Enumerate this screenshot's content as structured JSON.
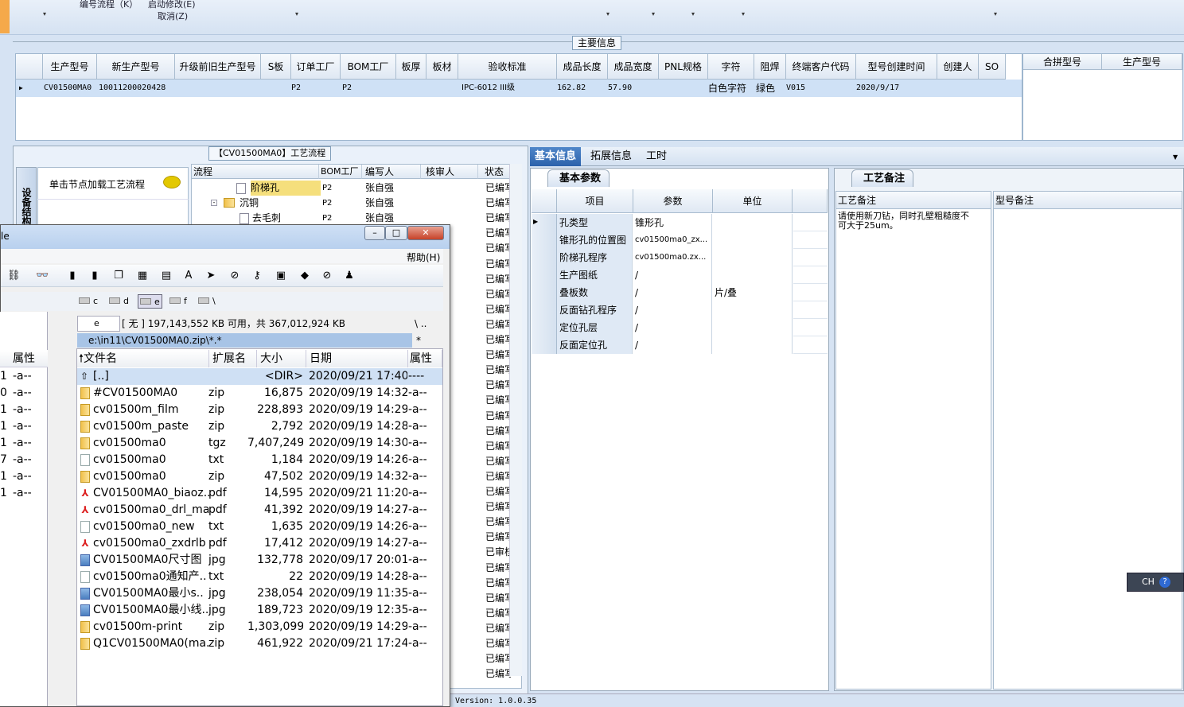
{
  "topbar": {
    "menu1": "编号流程（K）",
    "menu2": "启动修改(E)",
    "menu3": "取消(Z)",
    "dropdown_glyph": "▾"
  },
  "main_info": {
    "title": "主要信息",
    "columns": [
      "生产型号",
      "新生产型号",
      "升级前旧生产型号",
      "S板",
      "订单工厂",
      "BOM工厂",
      "板厚",
      "板材",
      "验收标准",
      "成品长度",
      "成品宽度",
      "PNL规格",
      "字符",
      "阻焊",
      "终端客户代码",
      "型号创建时间",
      "创建人",
      "SO"
    ],
    "row": [
      "CV01500MA0",
      "10011200020428",
      "",
      "",
      "P2",
      "P2",
      "",
      "",
      "IPC-6012 III级",
      "162.82",
      "57.90",
      "",
      "白色字符",
      "绿色",
      "V015",
      "2020/9/17",
      "",
      ""
    ],
    "side_columns": [
      "合拼型号",
      "生产型号"
    ]
  },
  "process": {
    "title": "【CV01500MA0】工艺流程",
    "sidebar_label": "设备结构",
    "load_hint": "单击节点加载工艺流程",
    "columns": [
      "流程",
      "BOM工厂",
      "编写人",
      "核审人",
      "状态"
    ],
    "rows": [
      {
        "name": "阶梯孔",
        "bom": "P2",
        "writer": "张自强",
        "status": "已编写"
      },
      {
        "name": "沉铜",
        "bom": "P2",
        "writer": "张自强",
        "status": "已编写"
      },
      {
        "name": "去毛刺",
        "bom": "P2",
        "writer": "张自强",
        "status": "已编写"
      }
    ],
    "status_list": [
      "已编写",
      "已编写",
      "已编写",
      "已编写",
      "已编写",
      "已编写",
      "已编写",
      "已编写",
      "已编写",
      "已编写",
      "已编写",
      "已编写",
      "已编写",
      "已编写",
      "已编写",
      "已编写",
      "已编写",
      "已编写",
      "已编写",
      "已编写",
      "已编写",
      "已编写",
      "已编写",
      "已编写",
      "已审核",
      "已编写",
      "已编写",
      "已编写",
      "已编写",
      "已编写",
      "已编写",
      "已编写",
      "已编写"
    ]
  },
  "right": {
    "tabs": [
      "基本信息",
      "拓展信息",
      "工时"
    ],
    "basic_tab": "基本参数",
    "param_columns": [
      "项目",
      "参数",
      "单位"
    ],
    "params": [
      {
        "k": "孔类型",
        "v": "锥形孔",
        "u": ""
      },
      {
        "k": "锥形孔的位置图",
        "v": "cv01500ma0_zx...",
        "u": ""
      },
      {
        "k": "阶梯孔程序",
        "v": "cv01500ma0.zx...",
        "u": ""
      },
      {
        "k": "生产图纸",
        "v": "/",
        "u": ""
      },
      {
        "k": "叠板数",
        "v": "/",
        "u": "片/叠"
      },
      {
        "k": "反面钻孔程序",
        "v": "/",
        "u": ""
      },
      {
        "k": "定位孔层",
        "v": "/",
        "u": ""
      },
      {
        "k": "反面定位孔",
        "v": "/",
        "u": ""
      }
    ],
    "remark_tab": "工艺备注",
    "remark_col1": "工艺备注",
    "remark_col2": "型号备注",
    "remark_text": "请使用新刀钻，同时孔壁粗糙度不可大于25um。",
    "version": "Version: 1.0.0.35",
    "ime": "CH"
  },
  "filemanager": {
    "title": "le",
    "help": "帮助(H)",
    "drives": [
      "c",
      "d",
      "e",
      "f",
      "\\"
    ],
    "drive_select": "e",
    "free_space": "[ 无 ] 197,143,552 KB 可用，共 367,012,924 KB",
    "path": "e:\\in11\\CV01500MA0.zip\\*.*",
    "left_path": "\\  ..",
    "left_filter": "*",
    "right_nav": "\\  ..",
    "right_filter": "*",
    "columns": [
      "文件名",
      "扩展名",
      "大小",
      "日期",
      "属性"
    ],
    "left_header": "属性",
    "left_rows": [
      {
        "n": "1",
        "a": "-a--"
      },
      {
        "n": "0",
        "a": "-a--"
      },
      {
        "n": "1",
        "a": "-a--"
      },
      {
        "n": "1",
        "a": "-a--"
      },
      {
        "n": "1",
        "a": "-a--"
      },
      {
        "n": "7",
        "a": "-a--"
      },
      {
        "n": "1",
        "a": "-a--"
      },
      {
        "n": "1",
        "a": "-a--"
      }
    ],
    "files": [
      {
        "name": "[..]",
        "ext": "",
        "size": "<DIR>",
        "date": "2020/09/21 17:40",
        "attr": "----",
        "icon": "up"
      },
      {
        "name": "#CV01500MA0",
        "ext": "zip",
        "size": "16,875",
        "date": "2020/09/19 14:32",
        "attr": "-a--",
        "icon": "folder"
      },
      {
        "name": "cv01500m_film",
        "ext": "zip",
        "size": "228,893",
        "date": "2020/09/19 14:29",
        "attr": "-a--",
        "icon": "folder"
      },
      {
        "name": "cv01500m_paste",
        "ext": "zip",
        "size": "2,792",
        "date": "2020/09/19 14:28",
        "attr": "-a--",
        "icon": "folder"
      },
      {
        "name": "cv01500ma0",
        "ext": "tgz",
        "size": "7,407,249",
        "date": "2020/09/19 14:30",
        "attr": "-a--",
        "icon": "folder"
      },
      {
        "name": "cv01500ma0",
        "ext": "txt",
        "size": "1,184",
        "date": "2020/09/19 14:26",
        "attr": "-a--",
        "icon": "txt"
      },
      {
        "name": "cv01500ma0",
        "ext": "zip",
        "size": "47,502",
        "date": "2020/09/19 14:32",
        "attr": "-a--",
        "icon": "folder"
      },
      {
        "name": "CV01500MA0_biaoz..",
        "ext": "pdf",
        "size": "14,595",
        "date": "2020/09/21 11:20",
        "attr": "-a--",
        "icon": "pdf"
      },
      {
        "name": "cv01500ma0_drl_map",
        "ext": "pdf",
        "size": "41,392",
        "date": "2020/09/19 14:27",
        "attr": "-a--",
        "icon": "pdf"
      },
      {
        "name": "cv01500ma0_new",
        "ext": "txt",
        "size": "1,635",
        "date": "2020/09/19 14:26",
        "attr": "-a--",
        "icon": "txt"
      },
      {
        "name": "cv01500ma0_zxdrlb",
        "ext": "pdf",
        "size": "17,412",
        "date": "2020/09/19 14:27",
        "attr": "-a--",
        "icon": "pdf"
      },
      {
        "name": "CV01500MA0尺寸图",
        "ext": "jpg",
        "size": "132,778",
        "date": "2020/09/17 20:01",
        "attr": "-a--",
        "icon": "jpg"
      },
      {
        "name": "cv01500ma0通知产..",
        "ext": "txt",
        "size": "22",
        "date": "2020/09/19 14:28",
        "attr": "-a--",
        "icon": "txt"
      },
      {
        "name": "CV01500MA0最小s..",
        "ext": "jpg",
        "size": "238,054",
        "date": "2020/09/19 11:35",
        "attr": "-a--",
        "icon": "jpg"
      },
      {
        "name": "CV01500MA0最小线..",
        "ext": "jpg",
        "size": "189,723",
        "date": "2020/09/19 12:35",
        "attr": "-a--",
        "icon": "jpg"
      },
      {
        "name": "cv01500m-print",
        "ext": "zip",
        "size": "1,303,099",
        "date": "2020/09/19 14:29",
        "attr": "-a--",
        "icon": "folder"
      },
      {
        "name": "Q1CV01500MA0(ma..",
        "ext": "zip",
        "size": "461,922",
        "date": "2020/09/21 17:24",
        "attr": "-a--",
        "icon": "folder"
      }
    ]
  }
}
